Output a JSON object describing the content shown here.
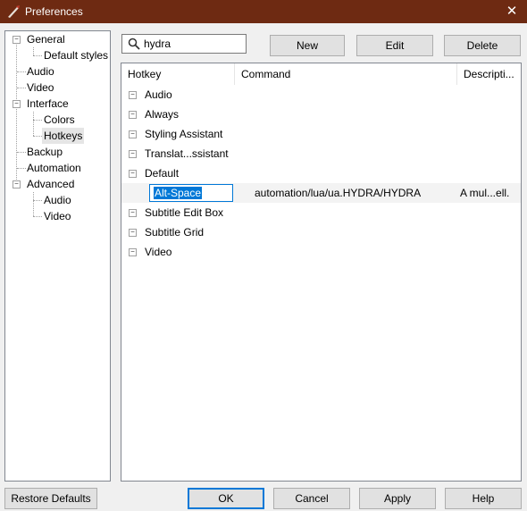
{
  "window": {
    "title": "Preferences",
    "close_glyph": "✕"
  },
  "tree": {
    "items": [
      {
        "label": "General",
        "expander": "−"
      },
      {
        "label": "Default styles"
      },
      {
        "label": "Audio"
      },
      {
        "label": "Video"
      },
      {
        "label": "Interface",
        "expander": "−"
      },
      {
        "label": "Colors"
      },
      {
        "label": "Hotkeys",
        "selected": true
      },
      {
        "label": "Backup"
      },
      {
        "label": "Automation"
      },
      {
        "label": "Advanced",
        "expander": "−"
      },
      {
        "label": "Audio"
      },
      {
        "label": "Video"
      }
    ]
  },
  "search": {
    "value": "hydra",
    "icon": "search-icon"
  },
  "toolbar": {
    "new_label": "New",
    "edit_label": "Edit",
    "delete_label": "Delete"
  },
  "grid": {
    "columns": [
      "Hotkey",
      "Command",
      "Descripti..."
    ],
    "groups": [
      {
        "label": "Audio",
        "expander": "−"
      },
      {
        "label": "Always",
        "expander": "−"
      },
      {
        "label": "Styling Assistant",
        "expander": "−"
      },
      {
        "label": "Translat...ssistant",
        "expander": "−"
      },
      {
        "label": "Default",
        "expander": "−"
      },
      {
        "label": "Subtitle Edit Box",
        "expander": "−"
      },
      {
        "label": "Subtitle Grid",
        "expander": "−"
      },
      {
        "label": "Video",
        "expander": "−"
      }
    ],
    "edit_row": {
      "hotkey": "Alt-Space",
      "command": "automation/lua/ua.HYDRA/HYDRA",
      "description": "A mul...ell."
    }
  },
  "footer": {
    "restore_label": "Restore Defaults",
    "ok_label": "OK",
    "cancel_label": "Cancel",
    "apply_label": "Apply",
    "help_label": "Help"
  },
  "colors": {
    "titlebar": "#6e2a12",
    "accent": "#0078d7"
  }
}
